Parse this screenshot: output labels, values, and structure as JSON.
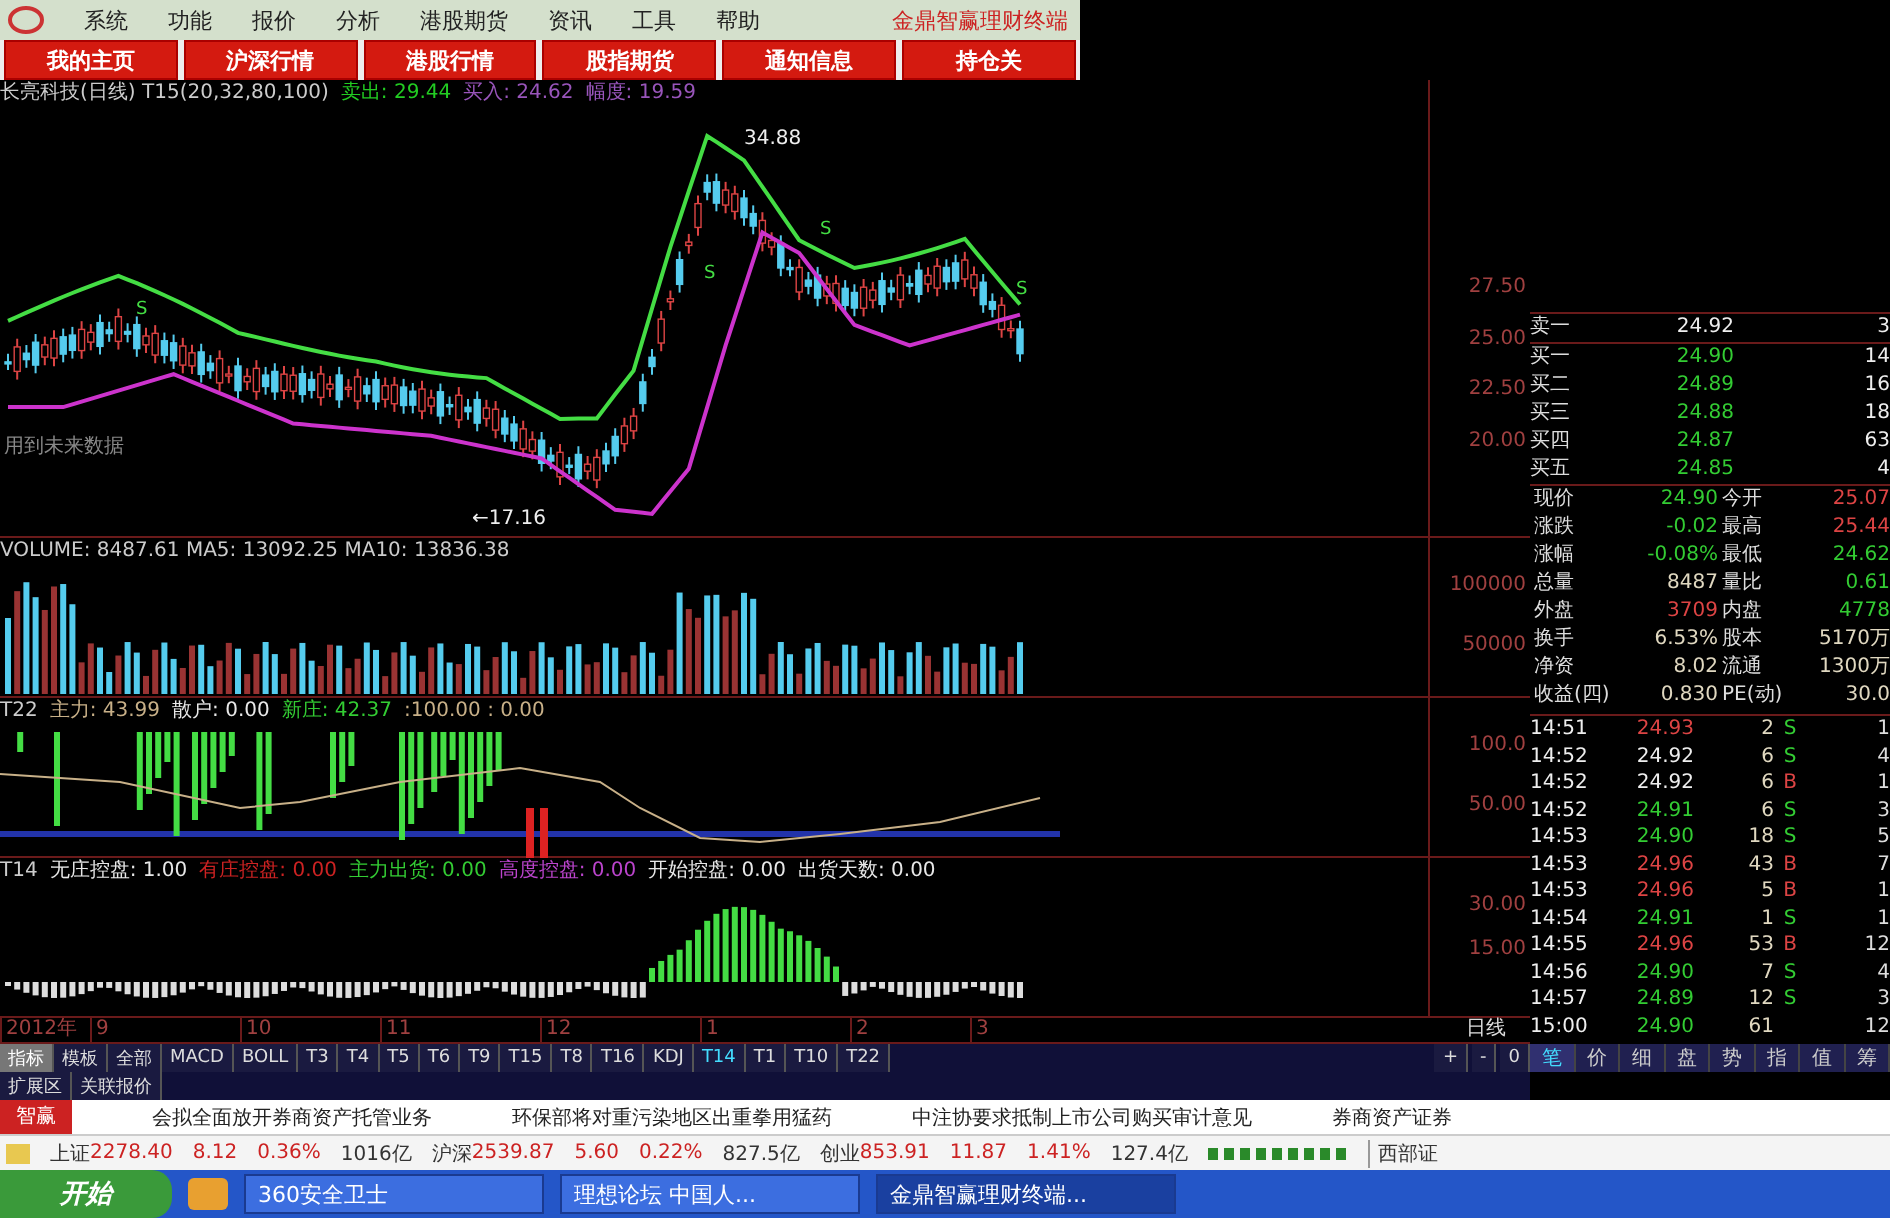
{
  "menu_bar": {
    "items": [
      "系统",
      "功能",
      "报价",
      "分析",
      "港股期货",
      "资讯",
      "工具",
      "帮助"
    ],
    "app_title": "金鼎智赢理财终端"
  },
  "nav_buttons": [
    "我的主页",
    "沪深行情",
    "港股行情",
    "股指期货",
    "通知信息",
    "持仓关"
  ],
  "main_chart": {
    "title": "长亮科技(日线) T15(20,32,80,100)",
    "legend": [
      {
        "label": "卖出:",
        "value": "29.44",
        "color": "#22cc22"
      },
      {
        "label": "买入:",
        "value": "24.62",
        "color": "#9955bb"
      },
      {
        "label": "幅度:",
        "value": "19.59",
        "color": "#9955bb"
      }
    ],
    "high_label": "34.88",
    "low_label": "←17.16",
    "signals": [
      "S",
      "S",
      "S",
      "S"
    ],
    "note": "用到未来数据",
    "axis": [
      "27.50",
      "25.00",
      "22.50",
      "20.00"
    ]
  },
  "volume": {
    "legend": "VOLUME: 8487.61  MA5: 13092.25  MA10: 13836.38",
    "axis": [
      "100000",
      "50000"
    ]
  },
  "t22": {
    "name": "T22",
    "legend": [
      {
        "label": "主力:",
        "value": "43.99",
        "color": "#c8b088"
      },
      {
        "label": "散户:",
        "value": "0.00",
        "color": "#e8e8e8"
      },
      {
        "label": "新庄:",
        "value": "42.37",
        "color": "#33cc33"
      },
      {
        "label": ":100.00 : 0.00",
        "color": "#c8b088"
      }
    ],
    "axis": [
      "100.0",
      "50.00"
    ]
  },
  "t14": {
    "name": "T14",
    "legend": [
      {
        "label": "无庄控盘:",
        "value": "1.00",
        "color": "#e8e8e8"
      },
      {
        "label": "有庄控盘:",
        "value": "0.00",
        "color": "#cc2222"
      },
      {
        "label": "主力出货:",
        "value": "0.00",
        "color": "#33cc33"
      },
      {
        "label": "高度控盘:",
        "value": "0.00",
        "color": "#bb44cc"
      },
      {
        "label": "开始控盘:",
        "value": "0.00",
        "color": "#e8e8e8"
      },
      {
        "label": "出货天数:",
        "value": "0.00",
        "color": "#e8e8e8"
      }
    ],
    "axis": [
      "30.00",
      "15.00"
    ]
  },
  "date_axis": [
    "2012年",
    "9",
    "10",
    "11",
    "12",
    "1",
    "2",
    "3"
  ],
  "period": "日线",
  "zoom_buttons": [
    "+",
    "-",
    "0"
  ],
  "mode_tabs": [
    {
      "label": "指标",
      "selected": true
    },
    {
      "label": "模板",
      "selected": false
    }
  ],
  "indicator_tabs": [
    {
      "label": "全部",
      "selected": false
    },
    {
      "label": "MACD",
      "selected": false
    },
    {
      "label": "BOLL",
      "selected": false
    },
    {
      "label": "T3",
      "selected": false
    },
    {
      "label": "T4",
      "selected": false
    },
    {
      "label": "T5",
      "selected": false
    },
    {
      "label": "T6",
      "selected": false
    },
    {
      "label": "T9",
      "selected": false
    },
    {
      "label": "T15",
      "selected": false
    },
    {
      "label": "T8",
      "selected": false
    },
    {
      "label": "T16",
      "selected": false
    },
    {
      "label": "KDJ",
      "selected": false
    },
    {
      "label": "T14",
      "selected": true
    },
    {
      "label": "T1",
      "selected": false
    },
    {
      "label": "T10",
      "selected": false
    },
    {
      "label": "T22",
      "selected": false
    }
  ],
  "extension_tabs": [
    "扩展区",
    "关联报价"
  ],
  "order_book": [
    {
      "kind": "ask",
      "label": "卖一",
      "price": "24.92",
      "volume": "3"
    },
    {
      "kind": "bid",
      "label": "买一",
      "price": "24.90",
      "volume": "14"
    },
    {
      "kind": "bid",
      "label": "买二",
      "price": "24.89",
      "volume": "16"
    },
    {
      "kind": "bid",
      "label": "买三",
      "price": "24.88",
      "volume": "18"
    },
    {
      "kind": "bid",
      "label": "买四",
      "price": "24.87",
      "volume": "63"
    },
    {
      "kind": "bid",
      "label": "买五",
      "price": "24.85",
      "volume": "4"
    }
  ],
  "stats": [
    {
      "label": "现价",
      "value": "24.90",
      "color": "#33cc33"
    },
    {
      "label": "今开",
      "value": "25.07",
      "color": "#dd4444"
    },
    {
      "label": "涨跌",
      "value": "-0.02",
      "color": "#33cc33"
    },
    {
      "label": "最高",
      "value": "25.44",
      "color": "#dd4444"
    },
    {
      "label": "涨幅",
      "value": "-0.08%",
      "color": "#33cc33"
    },
    {
      "label": "最低",
      "value": "24.62",
      "color": "#33cc33"
    },
    {
      "label": "总量",
      "value": "8487",
      "color": "#e0d8c0"
    },
    {
      "label": "量比",
      "value": "0.61",
      "color": "#33cc33"
    },
    {
      "label": "外盘",
      "value": "3709",
      "color": "#dd4444"
    },
    {
      "label": "内盘",
      "value": "4778",
      "color": "#33cc33"
    },
    {
      "label": "换手",
      "value": "6.53%",
      "color": "#e0d8c0"
    },
    {
      "label": "股本",
      "value": "5170万",
      "color": "#e0d8c0"
    },
    {
      "label": "净资",
      "value": "8.02",
      "color": "#e0d8c0"
    },
    {
      "label": "流通",
      "value": "1300万",
      "color": "#e0d8c0"
    },
    {
      "label": "收益(四)",
      "value": "0.830",
      "color": "#e0d8c0"
    },
    {
      "label": "PE(动)",
      "value": "30.0",
      "color": "#e0d8c0"
    }
  ],
  "trades": [
    {
      "time": "14:51",
      "price": "24.93",
      "color": "#dd4444",
      "volume": "2",
      "side": "S",
      "count": "1"
    },
    {
      "time": "14:52",
      "price": "24.92",
      "color": "#eeeeee",
      "volume": "6",
      "side": "S",
      "count": "4"
    },
    {
      "time": "14:52",
      "price": "24.92",
      "color": "#eeeeee",
      "volume": "6",
      "side": "B",
      "count": "1"
    },
    {
      "time": "14:52",
      "price": "24.91",
      "color": "#33cc33",
      "volume": "6",
      "side": "S",
      "count": "3"
    },
    {
      "time": "14:53",
      "price": "24.90",
      "color": "#33cc33",
      "volume": "18",
      "side": "S",
      "count": "5"
    },
    {
      "time": "14:53",
      "price": "24.96",
      "color": "#dd4444",
      "volume": "43",
      "side": "B",
      "count": "7"
    },
    {
      "time": "14:53",
      "price": "24.96",
      "color": "#dd4444",
      "volume": "5",
      "side": "B",
      "count": "1"
    },
    {
      "time": "14:54",
      "price": "24.91",
      "color": "#33cc33",
      "volume": "1",
      "side": "S",
      "count": "1"
    },
    {
      "time": "14:55",
      "price": "24.96",
      "color": "#dd4444",
      "volume": "53",
      "side": "B",
      "count": "12"
    },
    {
      "time": "14:56",
      "price": "24.90",
      "color": "#33cc33",
      "volume": "7",
      "side": "S",
      "count": "4"
    },
    {
      "time": "14:57",
      "price": "24.89",
      "color": "#33cc33",
      "volume": "12",
      "side": "S",
      "count": "3"
    },
    {
      "time": "15:00",
      "price": "24.90",
      "color": "#33cc33",
      "volume": "61",
      "count": "12"
    }
  ],
  "panel_tabs": [
    {
      "label": "笔",
      "selected": true
    },
    {
      "label": "价",
      "selected": false
    },
    {
      "label": "细",
      "selected": false
    },
    {
      "label": "盘",
      "selected": false
    },
    {
      "label": "势",
      "selected": false
    },
    {
      "label": "指",
      "selected": false
    },
    {
      "label": "值",
      "selected": false
    },
    {
      "label": "筹",
      "selected": false
    }
  ],
  "news_ticker": {
    "label": "智赢",
    "items": [
      "会拟全面放开券商资产托管业务",
      "环保部将对重污染地区出重拳用猛药",
      "中注协要求抵制上市公司购买审计意见",
      "券商资产证券"
    ]
  },
  "index_bar": {
    "indices": [
      {
        "name": "上证",
        "value": "2278.40",
        "change": "8.12",
        "pct": "0.36%",
        "amount": "1016亿"
      },
      {
        "name": "沪深",
        "value": "2539.87",
        "change": "5.60",
        "pct": "0.22%",
        "amount": "827.5亿"
      },
      {
        "name": "创业",
        "value": "853.91",
        "change": "11.87",
        "pct": "1.41%",
        "amount": "127.4亿"
      }
    ],
    "broker": "西部证"
  },
  "taskbar": {
    "start": "开始",
    "tasks": [
      {
        "label": "360安全卫士",
        "selected": false
      },
      {
        "label": "理想论坛 中国人...",
        "selected": false
      },
      {
        "label": "金鼎智赢理财终端...",
        "selected": true
      }
    ]
  }
}
